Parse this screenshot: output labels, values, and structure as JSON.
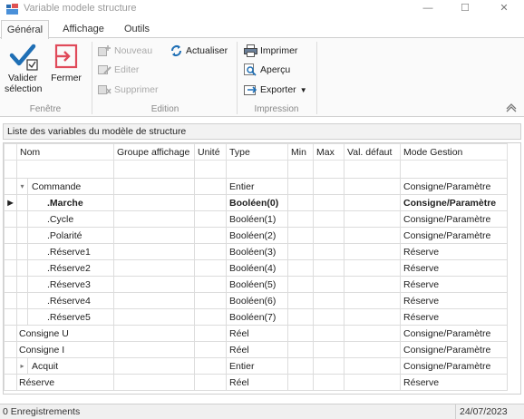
{
  "window": {
    "title": "Variable modele structure",
    "minimize": "—",
    "maximize": "☐",
    "close": "✕"
  },
  "tabs": [
    {
      "label": "Général",
      "active": true
    },
    {
      "label": "Affichage",
      "active": false
    },
    {
      "label": "Outils",
      "active": false
    }
  ],
  "ribbon": {
    "fenetre": {
      "group_label": "Fenêtre",
      "valider_label": "Valider sélection",
      "fermer_label": "Fermer"
    },
    "edition": {
      "group_label": "Edition",
      "nouveau_label": "Nouveau",
      "editer_label": "Editer",
      "supprimer_label": "Supprimer",
      "actualiser_label": "Actualiser"
    },
    "impression": {
      "group_label": "Impression",
      "imprimer_label": "Imprimer",
      "apercu_label": "Aperçu",
      "exporter_label": "Exporter"
    }
  },
  "panel": {
    "title": "Liste des variables du modèle de structure"
  },
  "table": {
    "columns": [
      "Nom",
      "Groupe affichage",
      "Unité",
      "Type",
      "Min",
      "Max",
      "Val. défaut",
      "Mode Gestion"
    ],
    "rows": [
      {
        "nom": "Commande",
        "groupe": "",
        "unite": "",
        "type": "Entier",
        "min": "",
        "max": "",
        "defaut": "",
        "mode": "Consigne/Paramètre",
        "level": 1,
        "expander": "▾",
        "indicator": "",
        "bold": false
      },
      {
        "nom": ".Marche",
        "groupe": "",
        "unite": "",
        "type": "Booléen(0)",
        "min": "",
        "max": "",
        "defaut": "",
        "mode": "Consigne/Paramètre",
        "level": 2,
        "expander": "",
        "indicator": "▶",
        "bold": true
      },
      {
        "nom": ".Cycle",
        "groupe": "",
        "unite": "",
        "type": "Booléen(1)",
        "min": "",
        "max": "",
        "defaut": "",
        "mode": "Consigne/Paramètre",
        "level": 2,
        "expander": "",
        "indicator": "",
        "bold": false
      },
      {
        "nom": ".Polarité",
        "groupe": "",
        "unite": "",
        "type": "Booléen(2)",
        "min": "",
        "max": "",
        "defaut": "",
        "mode": "Consigne/Paramètre",
        "level": 2,
        "expander": "",
        "indicator": "",
        "bold": false
      },
      {
        "nom": ".Réserve1",
        "groupe": "",
        "unite": "",
        "type": "Booléen(3)",
        "min": "",
        "max": "",
        "defaut": "",
        "mode": "Réserve",
        "level": 2,
        "expander": "",
        "indicator": "",
        "bold": false
      },
      {
        "nom": ".Réserve2",
        "groupe": "",
        "unite": "",
        "type": "Booléen(4)",
        "min": "",
        "max": "",
        "defaut": "",
        "mode": "Réserve",
        "level": 2,
        "expander": "",
        "indicator": "",
        "bold": false
      },
      {
        "nom": ".Réserve3",
        "groupe": "",
        "unite": "",
        "type": "Booléen(5)",
        "min": "",
        "max": "",
        "defaut": "",
        "mode": "Réserve",
        "level": 2,
        "expander": "",
        "indicator": "",
        "bold": false
      },
      {
        "nom": ".Réserve4",
        "groupe": "",
        "unite": "",
        "type": "Booléen(6)",
        "min": "",
        "max": "",
        "defaut": "",
        "mode": "Réserve",
        "level": 2,
        "expander": "",
        "indicator": "",
        "bold": false
      },
      {
        "nom": ".Réserve5",
        "groupe": "",
        "unite": "",
        "type": "Booléen(7)",
        "min": "",
        "max": "",
        "defaut": "",
        "mode": "Réserve",
        "level": 2,
        "expander": "",
        "indicator": "",
        "bold": false
      },
      {
        "nom": "Consigne U",
        "groupe": "",
        "unite": "",
        "type": "Réel",
        "min": "",
        "max": "",
        "defaut": "",
        "mode": "Consigne/Paramètre",
        "level": 0,
        "expander": "",
        "indicator": "",
        "bold": false
      },
      {
        "nom": "Consigne I",
        "groupe": "",
        "unite": "",
        "type": "Réel",
        "min": "",
        "max": "",
        "defaut": "",
        "mode": "Consigne/Paramètre",
        "level": 0,
        "expander": "",
        "indicator": "",
        "bold": false
      },
      {
        "nom": "Acquit",
        "groupe": "",
        "unite": "",
        "type": "Entier",
        "min": "",
        "max": "",
        "defaut": "",
        "mode": "Consigne/Paramètre",
        "level": 1,
        "expander": "▸",
        "indicator": "",
        "bold": false
      },
      {
        "nom": "Réserve",
        "groupe": "",
        "unite": "",
        "type": "Réel",
        "min": "",
        "max": "",
        "defaut": "",
        "mode": "Réserve",
        "level": 0,
        "expander": "",
        "indicator": "",
        "bold": false
      }
    ]
  },
  "status": {
    "count": "0 Enregistrements",
    "date": "24/07/2023"
  },
  "colors": {
    "accent_blue": "#1f6fb5",
    "close_red": "#e04a5a"
  }
}
